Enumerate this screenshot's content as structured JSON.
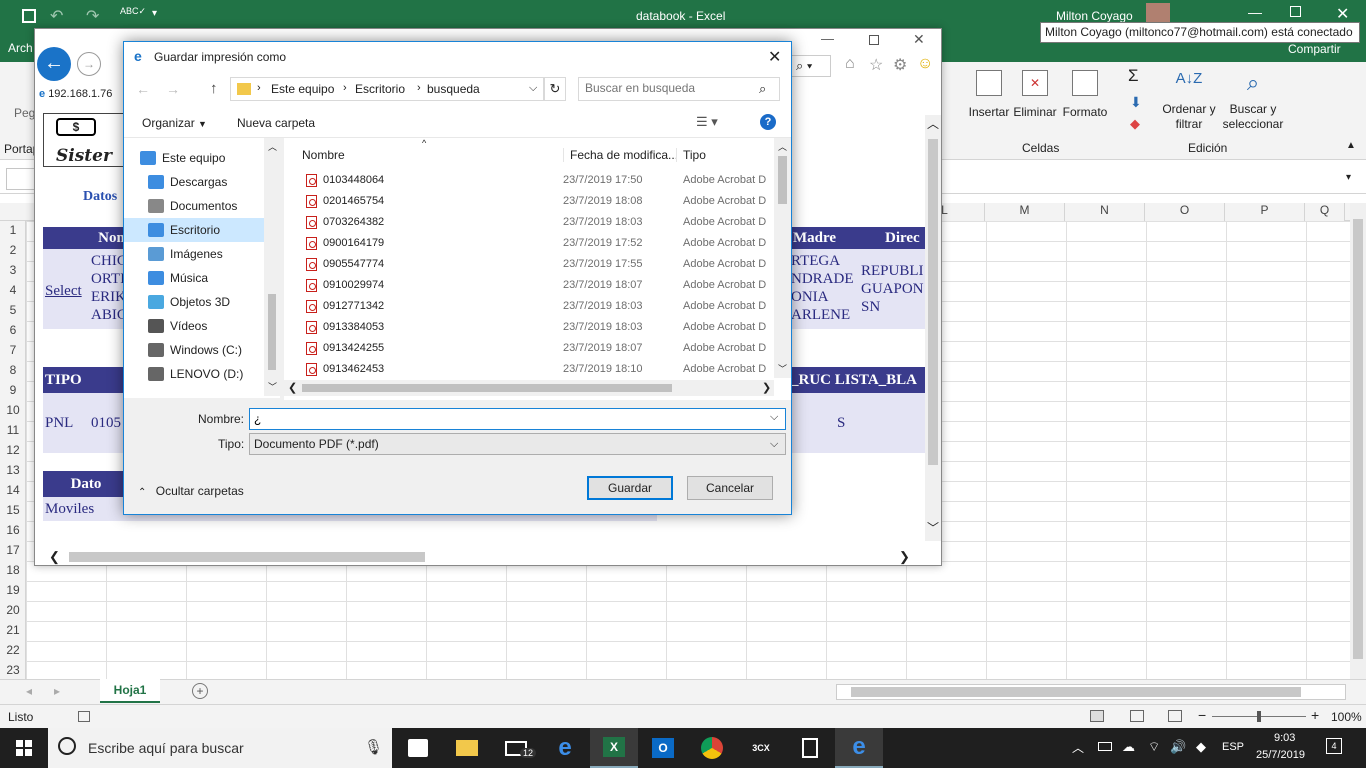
{
  "excel": {
    "title": "databook  -  Excel",
    "user": "Milton Coyago",
    "tooltip": "Milton Coyago (miltonco77@hotmail.com) está conectado",
    "share": "Compartir",
    "tab_partial": "Arch",
    "paste_partial": "Peg",
    "clip_partial": "Portap",
    "ribbon": {
      "insert": "Insertar",
      "delete": "Eliminar",
      "format": "Formato",
      "cells": "Celdas",
      "sort": "Ordenar y filtrar",
      "find": "Buscar y seleccionar",
      "edit": "Edición"
    },
    "columns": [
      "L",
      "M",
      "N",
      "O",
      "P",
      "Q"
    ],
    "rows": [
      "1",
      "2",
      "3",
      "4",
      "5",
      "6",
      "7",
      "8",
      "9",
      "10",
      "11",
      "12",
      "13",
      "14",
      "15",
      "16",
      "17",
      "18",
      "19",
      "20",
      "21",
      "22",
      "23"
    ],
    "sheet_tab": "Hoja1",
    "status": "Listo",
    "zoom": "100%"
  },
  "browser": {
    "url": "192.168.1.76",
    "page_label": "Datos",
    "header_nom": "Nom",
    "cells_names": [
      "CHIC",
      "ORTI",
      "ERIK",
      "ABIC"
    ],
    "select_link": "Select",
    "header_madre": "Madre",
    "header_direc": "Direc",
    "madre_vals": [
      "RTEGA",
      "NDRADE",
      "ONIA",
      "ARLENE"
    ],
    "direc_vals": [
      "REPUBLI",
      "GUAPON",
      "SN"
    ],
    "tipo": "TIPO",
    "ruc_hdr": "_RUC LISTA_BLA",
    "pnl": "PNL",
    "pnl_num": "0105",
    "s_val": "S",
    "dato": "Dato",
    "moviles": "Moviles",
    "logo": "Sister"
  },
  "dialog": {
    "title": "Guardar impresión como",
    "breadcrumb": [
      "Este equipo",
      "Escritorio",
      "busqueda"
    ],
    "search_placeholder": "Buscar en busqueda",
    "organize": "Organizar",
    "new_folder": "Nueva carpeta",
    "nav": [
      "Este equipo",
      "Descargas",
      "Documentos",
      "Escritorio",
      "Imágenes",
      "Música",
      "Objetos 3D",
      "Vídeos",
      "Windows (C:)",
      "LENOVO (D:)"
    ],
    "col_name": "Nombre",
    "col_date": "Fecha de modifica...",
    "col_type": "Tipo",
    "files": [
      {
        "name": "0103448064",
        "date": "23/7/2019 17:50",
        "type": "Adobe Acrobat D"
      },
      {
        "name": "0201465754",
        "date": "23/7/2019 18:08",
        "type": "Adobe Acrobat D"
      },
      {
        "name": "0703264382",
        "date": "23/7/2019 18:03",
        "type": "Adobe Acrobat D"
      },
      {
        "name": "0900164179",
        "date": "23/7/2019 17:52",
        "type": "Adobe Acrobat D"
      },
      {
        "name": "0905547774",
        "date": "23/7/2019 17:55",
        "type": "Adobe Acrobat D"
      },
      {
        "name": "0910029974",
        "date": "23/7/2019 18:07",
        "type": "Adobe Acrobat D"
      },
      {
        "name": "0912771342",
        "date": "23/7/2019 18:03",
        "type": "Adobe Acrobat D"
      },
      {
        "name": "0913384053",
        "date": "23/7/2019 18:03",
        "type": "Adobe Acrobat D"
      },
      {
        "name": "0913424255",
        "date": "23/7/2019 18:07",
        "type": "Adobe Acrobat D"
      },
      {
        "name": "0913462453",
        "date": "23/7/2019 18:10",
        "type": "Adobe Acrobat D"
      }
    ],
    "filename_label": "Nombre:",
    "filename_value": "¿",
    "type_label": "Tipo:",
    "type_value": "Documento PDF (*.pdf)",
    "hide_folders": "Ocultar carpetas",
    "save": "Guardar",
    "cancel": "Cancelar"
  },
  "taskbar": {
    "search": "Escribe aquí para buscar",
    "lang": "ESP",
    "time": "9:03",
    "date": "25/7/2019",
    "mail_badge": "12",
    "notif": "4"
  }
}
